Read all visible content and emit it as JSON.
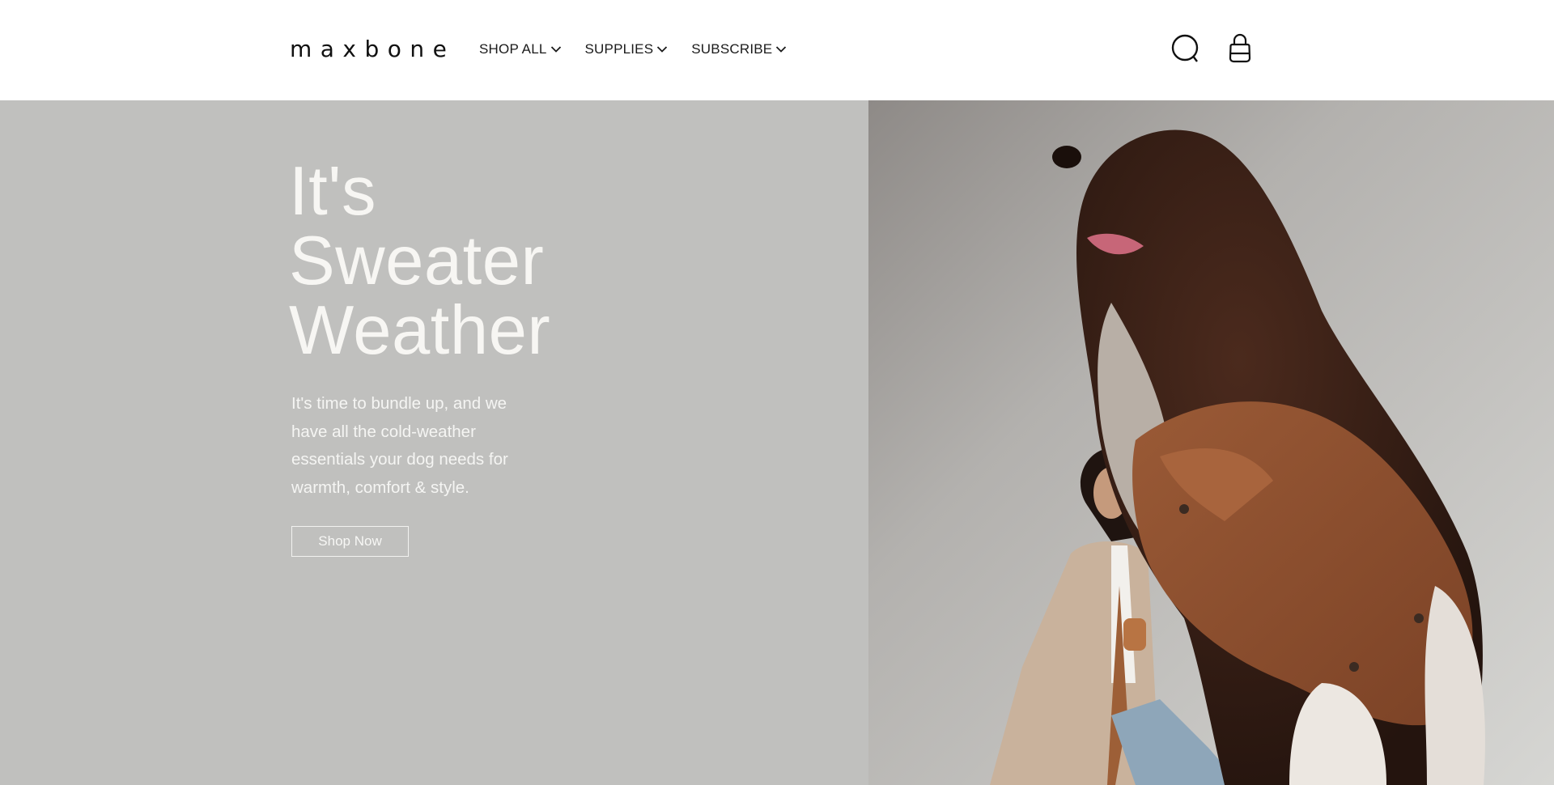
{
  "brand": {
    "logo_text": "maxbone"
  },
  "nav": {
    "items": [
      {
        "label": "SHOP ALL"
      },
      {
        "label": "SUPPLIES"
      },
      {
        "label": "SUBSCRIBE"
      }
    ]
  },
  "header_icons": {
    "search": "search-icon",
    "bag": "shopping-bag-icon"
  },
  "hero": {
    "title_line1": "It's",
    "title_line2": "Sweater",
    "title_line3": "Weather",
    "subtitle": "It's time to bundle up, and we have all the cold-weather essentials your dog needs for warmth, comfort & style.",
    "cta_label": "Shop Now",
    "background_color": "#c0c0be",
    "image_subject": "dog-in-brown-jacket-with-woman"
  }
}
